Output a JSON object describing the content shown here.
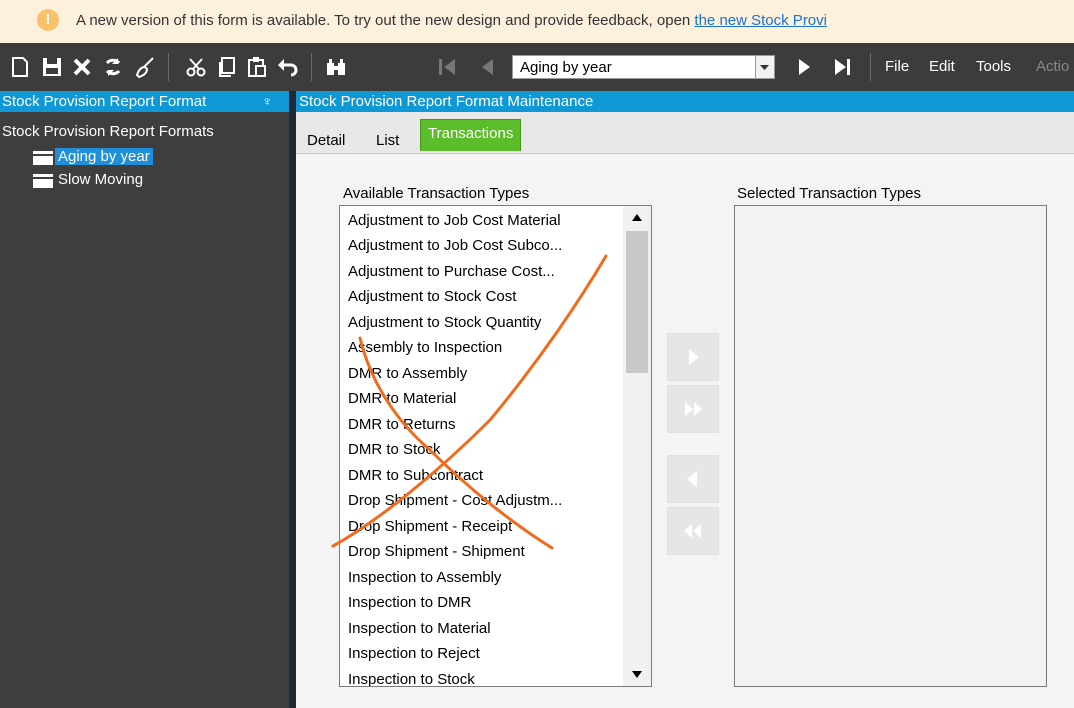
{
  "banner": {
    "icon": "warning-icon",
    "warn_glyph": "!",
    "message": "A new version of this form is available. To try out the new design and provide feedback, open ",
    "link_text": "the new Stock Provi"
  },
  "toolbar": {
    "icons": [
      "new-icon",
      "save-icon",
      "delete-icon",
      "refresh-icon",
      "clear-icon",
      "cut-icon",
      "copy-icon",
      "paste-icon",
      "undo-icon",
      "find-icon",
      "first-record-icon",
      "previous-record-icon",
      "next-record-icon",
      "last-record-icon"
    ],
    "record_select": "Aging by year",
    "menus": [
      "File",
      "Edit",
      "Tools",
      "Actio"
    ]
  },
  "sidebar": {
    "title": "Stock Provision Report Format",
    "pin_glyph": "♆",
    "root": "Stock Provision Report Formats",
    "items": [
      {
        "label": "Aging by year",
        "selected": true
      },
      {
        "label": "Slow Moving",
        "selected": false
      }
    ]
  },
  "main": {
    "title": "Stock Provision Report Format Maintenance",
    "tabs": [
      "Detail",
      "List",
      "Transactions"
    ],
    "active_tab": "Transactions",
    "available_label": "Available Transaction Types",
    "selected_label": "Selected Transaction Types",
    "available_items": [
      "Adjustment to Job Cost Material",
      "Adjustment to Job Cost Subco...",
      "Adjustment to Purchase Cost...",
      "Adjustment to Stock Cost",
      "Adjustment to Stock Quantity",
      "Assembly to Inspection",
      "DMR to Assembly",
      "DMR to Material",
      "DMR to Returns",
      "DMR to Stock",
      "DMR to Subcontract",
      "Drop Shipment - Cost Adjustm...",
      "Drop Shipment - Receipt",
      "Drop Shipment - Shipment",
      "Inspection to Assembly",
      "Inspection to DMR",
      "Inspection to Material",
      "Inspection to Reject",
      "Inspection to Stock"
    ],
    "selected_items": [],
    "move_buttons": [
      "add-one-icon",
      "add-all-icon",
      "remove-one-icon",
      "remove-all-icon"
    ]
  },
  "colors": {
    "accent": "#0e98d6",
    "active_tab": "#5bbd2a",
    "annotation": "#f26a1b",
    "banner_bg": "#fdf0dd",
    "toolbar_bg": "#3c3c3c"
  }
}
